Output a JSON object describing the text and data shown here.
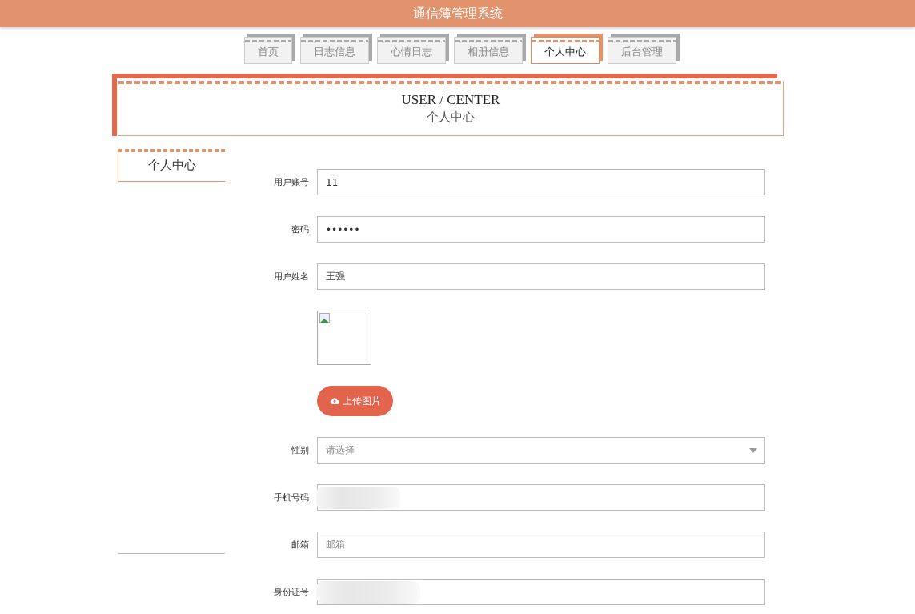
{
  "header": {
    "title": "通信簿管理系统"
  },
  "tabs": [
    {
      "label": "首页",
      "selected": false
    },
    {
      "label": "日志信息",
      "selected": false
    },
    {
      "label": "心情日志",
      "selected": false
    },
    {
      "label": "相册信息",
      "selected": false
    },
    {
      "label": "个人中心",
      "selected": true
    },
    {
      "label": "后台管理",
      "selected": false
    }
  ],
  "banner": {
    "title": "USER / CENTER",
    "subtitle": "个人中心"
  },
  "sidebar": {
    "items": [
      {
        "label": "个人中心",
        "selected": true
      }
    ]
  },
  "form": {
    "fields": [
      {
        "kind": "text",
        "label": "用户账号",
        "value": "11"
      },
      {
        "kind": "text",
        "label": "密码",
        "value": "••••••"
      },
      {
        "kind": "text",
        "label": "用户姓名",
        "value": "王强"
      },
      {
        "kind": "image",
        "button": "上传图片"
      },
      {
        "kind": "select",
        "label": "性别",
        "placeholder": "请选择"
      },
      {
        "kind": "redacted",
        "label": "手机号码"
      },
      {
        "kind": "text",
        "label": "邮箱",
        "placeholder": "邮箱"
      },
      {
        "kind": "redacted",
        "label": "身份证号"
      }
    ]
  }
}
